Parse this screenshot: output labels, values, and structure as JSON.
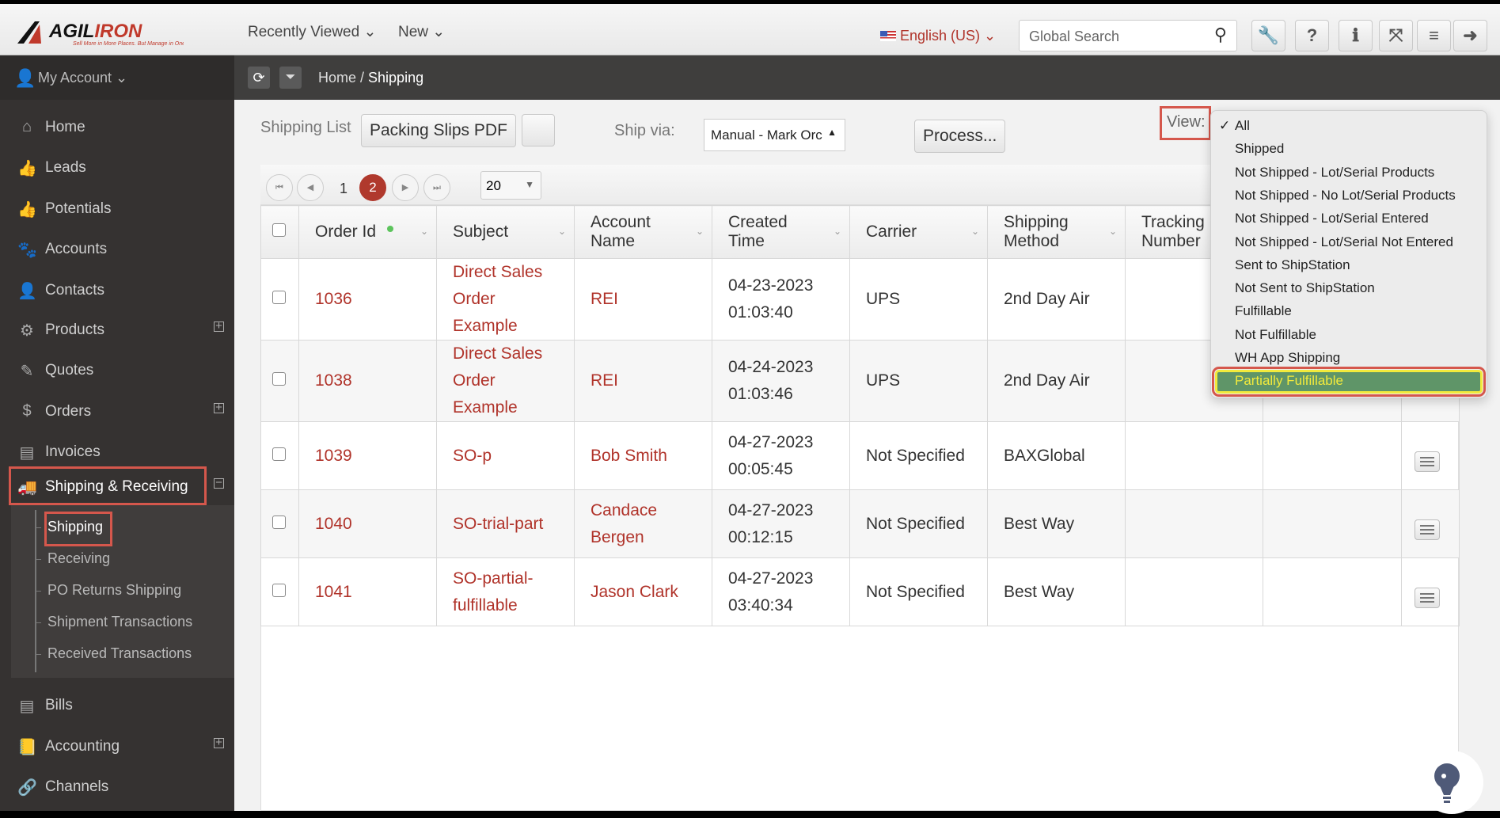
{
  "brand": {
    "name": "AGILIRON",
    "tagline": "Sell More in More Places. But Manage in One."
  },
  "topnav": {
    "recently_viewed": "Recently Viewed",
    "new": "New",
    "language": "English (US)",
    "search_placeholder": "Global Search"
  },
  "toolbar_icons": [
    "wrench-icon",
    "help-icon",
    "info-icon",
    "fullscreen-icon",
    "menu-icon",
    "logout-icon"
  ],
  "account": "My Account",
  "breadcrumb": {
    "home": "Home",
    "current": "Shipping"
  },
  "sidebar": {
    "items": [
      {
        "label": "Home",
        "icon": "home-icon",
        "glyph": "⌂"
      },
      {
        "label": "Leads",
        "icon": "thumbs-up-outline-icon",
        "glyph": "👍"
      },
      {
        "label": "Potentials",
        "icon": "thumbs-up-icon",
        "glyph": "👍"
      },
      {
        "label": "Accounts",
        "icon": "paw-icon",
        "glyph": "🐾"
      },
      {
        "label": "Contacts",
        "icon": "user-icon",
        "glyph": "👤"
      },
      {
        "label": "Products",
        "icon": "gears-icon",
        "glyph": "⚙",
        "expand": true
      },
      {
        "label": "Quotes",
        "icon": "edit-icon",
        "glyph": "✎"
      },
      {
        "label": "Orders",
        "icon": "dollar-icon",
        "glyph": "$",
        "expand": true
      },
      {
        "label": "Invoices",
        "icon": "document-icon",
        "glyph": "▤"
      },
      {
        "label": "Shipping & Receiving",
        "icon": "truck-icon",
        "glyph": "🚚",
        "collapse": true
      },
      {
        "label": "Bills",
        "icon": "file-icon",
        "glyph": "▤"
      },
      {
        "label": "Accounting",
        "icon": "book-icon",
        "glyph": "📒",
        "expand": true
      },
      {
        "label": "Channels",
        "icon": "link-icon",
        "glyph": "🔗"
      }
    ],
    "subitems": [
      "Shipping",
      "Receiving",
      "PO Returns Shipping",
      "Shipment Transactions",
      "Received Transactions"
    ]
  },
  "controls": {
    "shipping_list": "Shipping List",
    "packing_slips": "Packing Slips PDF",
    "ship_via_label": "Ship via:",
    "ship_via_value": "Manual - Mark Orc",
    "process": "Process...",
    "view_label": "View:"
  },
  "pager": {
    "pages": [
      "1",
      "2"
    ],
    "current": "2",
    "page_size": "20"
  },
  "table": {
    "columns": [
      "Order Id",
      "Subject",
      "Account Name",
      "Created Time",
      "Carrier",
      "Shipping Method",
      "Tracking Number"
    ],
    "rows": [
      {
        "order_id": "1036",
        "subject": "Direct Sales Order Example",
        "account": "REI",
        "created": "04-23-2023 01:03:40",
        "carrier": "UPS",
        "method": "2nd Day Air"
      },
      {
        "order_id": "1038",
        "subject": "Direct Sales Order Example",
        "account": "REI",
        "created": "04-24-2023 01:03:46",
        "carrier": "UPS",
        "method": "2nd Day Air"
      },
      {
        "order_id": "1039",
        "subject": "SO-p",
        "account": "Bob Smith",
        "created": "04-27-2023 00:05:45",
        "carrier": "Not Specified",
        "method": "BAXGlobal"
      },
      {
        "order_id": "1040",
        "subject": "SO-trial-part",
        "account": "Candace Bergen",
        "created": "04-27-2023 00:12:15",
        "carrier": "Not Specified",
        "method": "Best Way"
      },
      {
        "order_id": "1041",
        "subject": "SO-partial-fulfillable",
        "account": "Jason Clark",
        "created": "04-27-2023 03:40:34",
        "carrier": "Not Specified",
        "method": "Best Way"
      }
    ]
  },
  "view_dropdown": {
    "selected": "All",
    "highlighted": "Partially Fulfillable",
    "options": [
      "All",
      "Shipped",
      "Not Shipped - Lot/Serial Products",
      "Not Shipped - No Lot/Serial Products",
      "Not Shipped - Lot/Serial Entered",
      "Not Shipped - Lot/Serial Not Entered",
      "Sent to ShipStation",
      "Not Sent to ShipStation",
      "Fulfillable",
      "Not Fulfillable",
      "WH App Shipping",
      "Partially Fulfillable"
    ]
  },
  "colors": {
    "accent_red": "#b0332a",
    "highlight_green": "#5f9568",
    "highlight_text": "#f2ea3c",
    "annotation_box": "#d5574c"
  }
}
